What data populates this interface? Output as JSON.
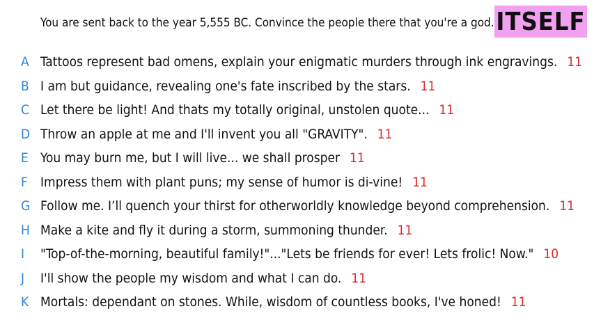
{
  "prompt": "You are sent back to the year 5,555 BC. Convince the people there that you're a god.",
  "badge": "ITSELF",
  "colors": {
    "letter": "#2f86d6",
    "score": "#e0262b",
    "badge_bg": "#f2a0f0"
  },
  "answers": [
    {
      "letter": "A",
      "text": "Tattoos represent bad omens, explain your enigmatic murders through ink engravings.",
      "score": "11"
    },
    {
      "letter": "B",
      "text": "I am but guidance, revealing one's fate inscribed by the stars.",
      "score": "11"
    },
    {
      "letter": "C",
      "text": "Let there be light! And thats my totally original, unstolen quote...",
      "score": "11"
    },
    {
      "letter": "D",
      "text": "Throw an apple at me and I'll invent you all \"GRAVITY\".",
      "score": "11"
    },
    {
      "letter": "E",
      "text": "You may burn me, but I will live... we shall prosper",
      "score": "11"
    },
    {
      "letter": "F",
      "text": "Impress them with plant puns; my sense of humor is di-vine!",
      "score": "11"
    },
    {
      "letter": "G",
      "text": "Follow me. I’ll quench your thirst for otherworldly knowledge beyond comprehension.",
      "score": "11"
    },
    {
      "letter": "H",
      "text": "Make a kite and fly it during a storm, summoning thunder.",
      "score": "11"
    },
    {
      "letter": "I",
      "text": "\"Top-of-the-morning, beautiful family!\"...\"Lets be friends for ever! Lets frolic! Now.\"",
      "score": "10"
    },
    {
      "letter": "J",
      "text": "I'll show the people my wisdom and what I can do.",
      "score": "11"
    },
    {
      "letter": "K",
      "text": "Mortals: dependant on stones. While, wisdom of countless books, I've honed!",
      "score": "11"
    }
  ]
}
